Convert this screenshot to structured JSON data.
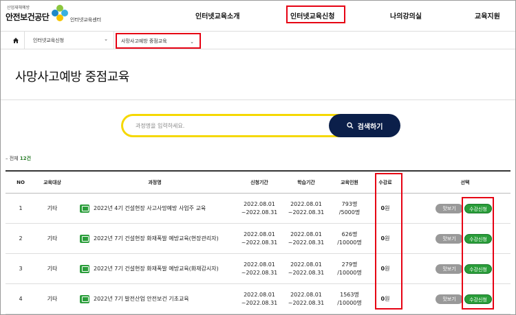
{
  "header": {
    "logo_small": "산업재해예방",
    "logo_main": "안전보건공단",
    "logo_sub": "인터넷교육센터",
    "nav": [
      "인터넷교육소개",
      "인터넷교육신청",
      "나의강의실",
      "교육지원"
    ]
  },
  "breadcrumb": {
    "level1": "인터넷교육신청",
    "level2": "사망사고예방 중점교육"
  },
  "page_title": "사망사고예방 중점교육",
  "search": {
    "placeholder": "과정명을 입력하세요.",
    "button_label": "검색하기"
  },
  "count": {
    "prefix": "전체",
    "value": "12건"
  },
  "table": {
    "headers": [
      "NO",
      "교육대상",
      "과정명",
      "신청기간",
      "학습기간",
      "교육인원",
      "수강료",
      "선택"
    ],
    "rows": [
      {
        "no": "1",
        "target": "기타",
        "title": "2022년 4기 건설현장 사고사망예방 사업주 교육",
        "apply_start": "2022.08.01",
        "apply_end": "~2022.08.31",
        "study_start": "2022.08.01",
        "study_end": "~2022.08.31",
        "people": "793명",
        "capacity": "/5000명",
        "fee": "0",
        "fee_unit": "원",
        "view": "맛보기",
        "apply": "수강신청"
      },
      {
        "no": "2",
        "target": "기타",
        "title": "2022년 7기 건설현장 화재폭발 예방교육(현장관리자)",
        "apply_start": "2022.08.01",
        "apply_end": "~2022.08.31",
        "study_start": "2022.08.01",
        "study_end": "~2022.08.31",
        "people": "626명",
        "capacity": "/10000명",
        "fee": "0",
        "fee_unit": "원",
        "view": "맛보기",
        "apply": "수강신청"
      },
      {
        "no": "3",
        "target": "기타",
        "title": "2022년 7기 건설현장 화재폭발 예방교육(화재감시자)",
        "apply_start": "2022.08.01",
        "apply_end": "~2022.08.31",
        "study_start": "2022.08.01",
        "study_end": "~2022.08.31",
        "people": "279명",
        "capacity": "/10000명",
        "fee": "0",
        "fee_unit": "원",
        "view": "맛보기",
        "apply": "수강신청"
      },
      {
        "no": "4",
        "target": "기타",
        "title": "2022년 7기 발전산업 안전보건 기초교육",
        "apply_start": "2022.08.01",
        "apply_end": "~2022.08.31",
        "study_start": "2022.08.01",
        "study_end": "~2022.08.31",
        "people": "1563명",
        "capacity": "/10000명",
        "fee": "0",
        "fee_unit": "원",
        "view": "맛보기",
        "apply": "수강신청"
      }
    ]
  },
  "colors": {
    "highlight": "#e60012",
    "search_border": "#f5d800",
    "search_button": "#0b1f4a",
    "green": "#2a9d3a"
  }
}
